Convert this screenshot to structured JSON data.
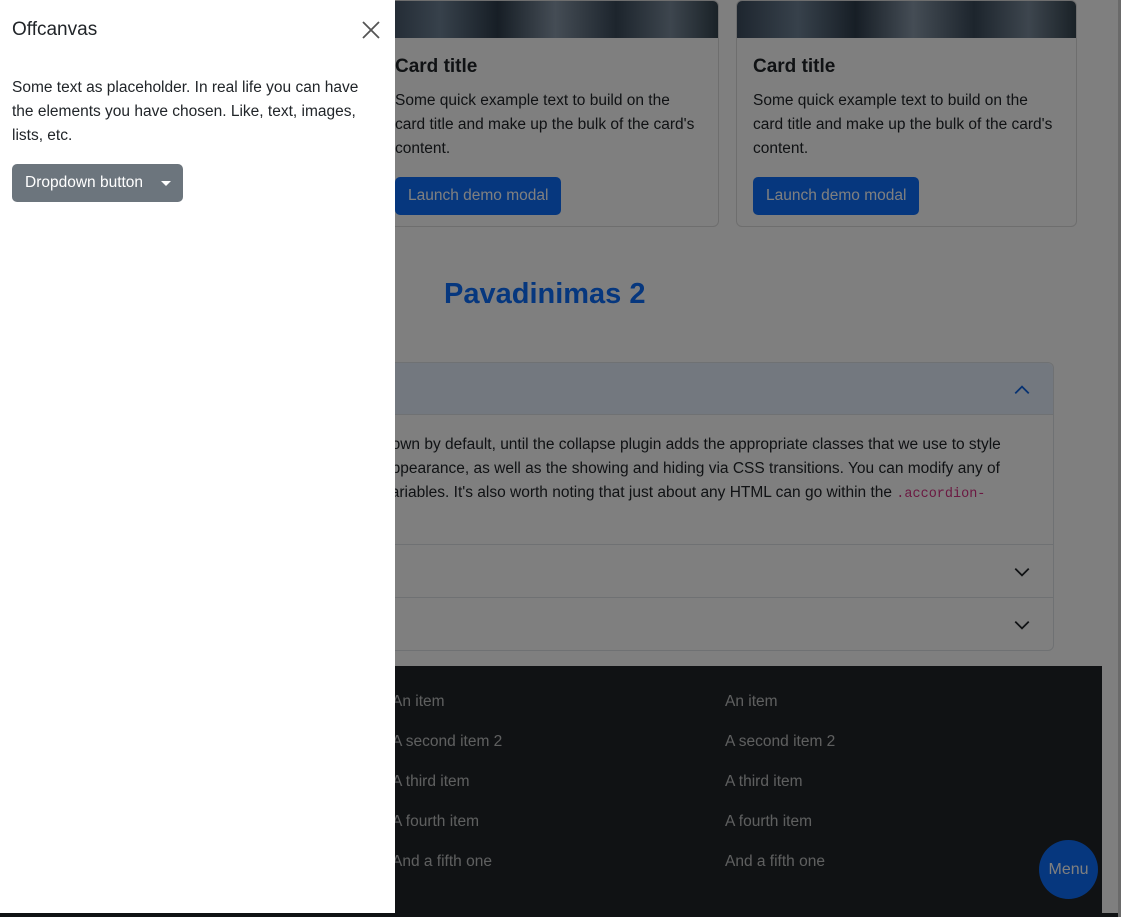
{
  "cards": [
    {
      "title": "Card title",
      "text": "Some quick example text to build on the card title and make up the bulk of the card's content.",
      "button": "Launch demo modal"
    },
    {
      "title": "Card title",
      "text": "Some quick example text to build on the card title and make up the bulk of the card's content.",
      "button": "Launch demo modal"
    }
  ],
  "section_title": "Pavadinimas 2",
  "accordion": {
    "body_text": "hown by default, until the collapse plugin adds the appropriate classes that we use to style appearance, as well as the showing and hiding via CSS transitions. You can modify any of variables. It's also worth noting that just about any HTML can go within the ",
    "body_code": ".accordion-"
  },
  "footer_lists": [
    [
      "An item",
      "A second item 2",
      "A third item",
      "A fourth item",
      "And a fifth one"
    ],
    [
      "An item",
      "A second item 2",
      "A third item",
      "A fourth item",
      "And a fifth one"
    ]
  ],
  "menu_button": "Menu",
  "offcanvas": {
    "title": "Offcanvas",
    "text": "Some text as placeholder. In real life you can have the elements you have chosen. Like, text, images, lists, etc.",
    "dropdown_label": "Dropdown button"
  },
  "colors": {
    "primary": "#0d6efd",
    "secondary": "#6c757d",
    "footer_bg": "#212529"
  }
}
